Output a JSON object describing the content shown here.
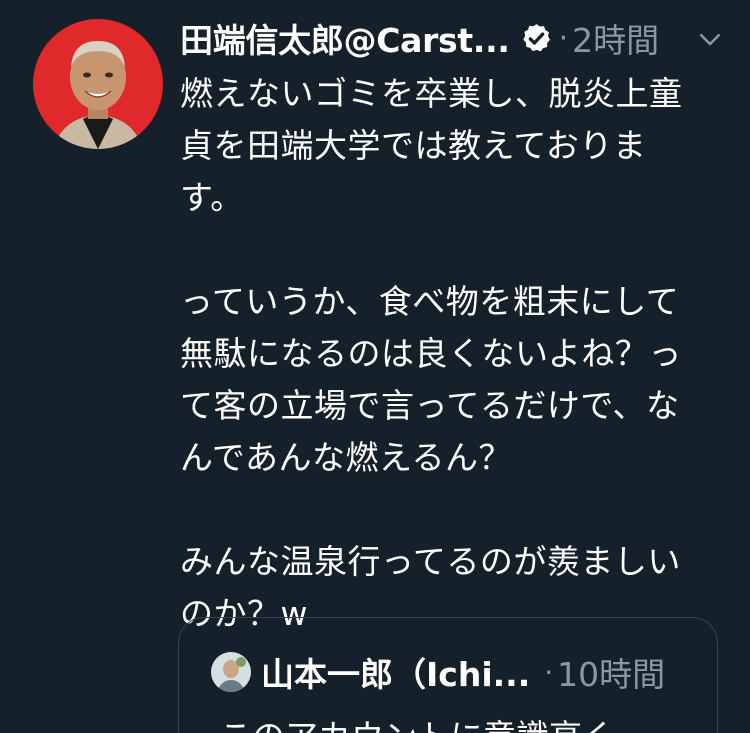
{
  "tweet": {
    "display_name": "田端信太郎@Carst...",
    "separator": "·",
    "time": "2時間",
    "body": "燃えないゴミを卒業し、脱炎上童\n貞を田端大学では教えておりま\nす。\n\nっていうか、食べ物を粗末にして\n無駄になるのは良くないよね？っ\nて客の立場で言ってるだけで、な\nんであんな燃えるん？\n\nみんな温泉行ってるのが羨ましい\nのか？w"
  },
  "quote": {
    "display_name": "山本一郎（Ichi...",
    "separator": "·",
    "time": "10時間",
    "text_partial": "このアカウントに意識高く"
  },
  "colors": {
    "background": "#15202b",
    "text": "#ffffff",
    "muted": "#8899a6",
    "border": "#38444d",
    "avatar_bg": "#e0292b"
  },
  "icons": {
    "verified": "verified-badge-icon",
    "caret": "chevron-down-icon"
  }
}
